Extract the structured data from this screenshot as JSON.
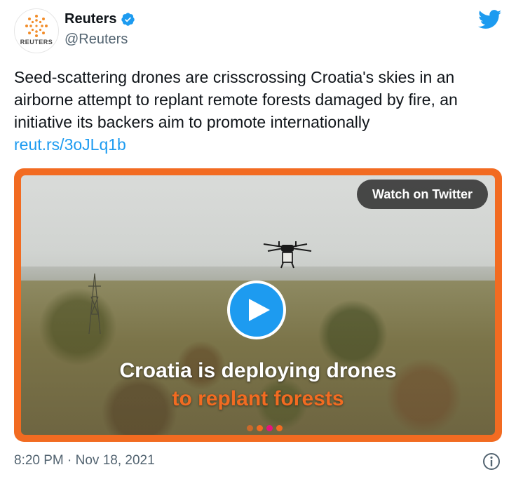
{
  "author": {
    "display_name": "Reuters",
    "handle": "@Reuters",
    "avatar_wordmark": "REUTERS",
    "verified": true
  },
  "tweet": {
    "text": "Seed-scattering drones are crisscrossing Croatia's skies in an airborne attempt to replant remote forests damaged by fire, an initiative its backers aim to promote internationally",
    "link": "reut.rs/3oJLq1b"
  },
  "media": {
    "watch_label": "Watch on Twitter",
    "caption_line1": "Croatia is deploying drones",
    "caption_line2": "to replant forests",
    "play_icon": "play-icon"
  },
  "footer": {
    "timestamp": "8:20 PM · Nov 18, 2021",
    "info_icon": "info-icon"
  },
  "colors": {
    "twitter_blue": "#1d9bf0",
    "reuters_orange": "#f26b21",
    "text_primary": "#0f1419",
    "text_secondary": "#536471"
  }
}
